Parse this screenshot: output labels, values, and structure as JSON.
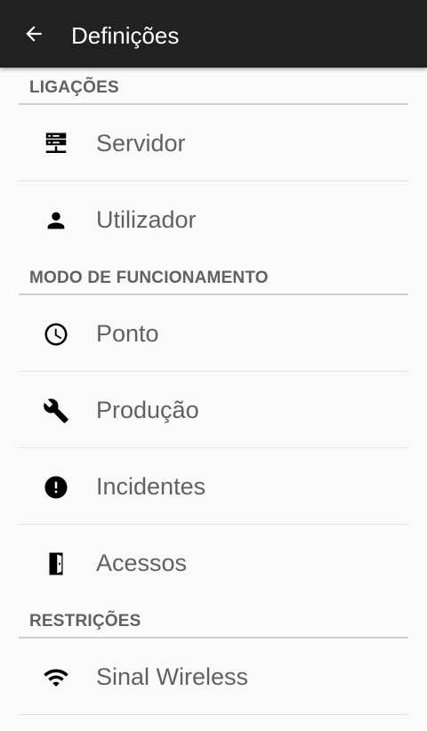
{
  "appbar": {
    "back_icon": "arrow-back-icon",
    "title": "Definições"
  },
  "sections": [
    {
      "header": "LIGAÇÕES",
      "items": [
        {
          "label": "Servidor",
          "icon": "server-icon"
        },
        {
          "label": "Utilizador",
          "icon": "person-icon"
        }
      ]
    },
    {
      "header": "MODO DE FUNCIONAMENTO",
      "items": [
        {
          "label": "Ponto",
          "icon": "clock-icon"
        },
        {
          "label": "Produção",
          "icon": "wrench-icon"
        },
        {
          "label": "Incidentes",
          "icon": "alert-icon"
        },
        {
          "label": "Acessos",
          "icon": "door-icon"
        }
      ]
    },
    {
      "header": "RESTRIÇÕES",
      "items": [
        {
          "label": "Sinal Wireless",
          "icon": "wifi-icon"
        }
      ]
    }
  ],
  "colors": {
    "appbar": "#212121",
    "background": "#fafafa",
    "text": "#616161",
    "icon": "#000000"
  }
}
